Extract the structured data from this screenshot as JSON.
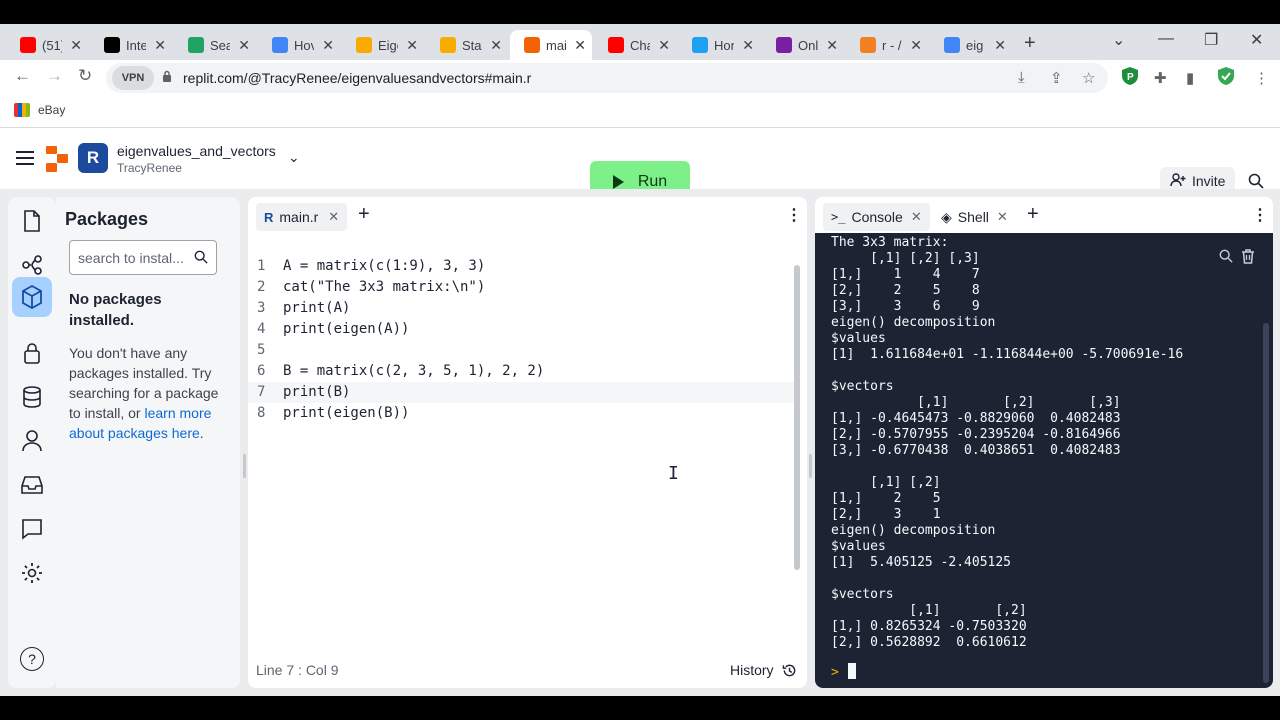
{
  "browser": {
    "tabs": [
      {
        "label": "(51)",
        "icon": "youtube-icon",
        "color": "#ff0000"
      },
      {
        "label": "Inte",
        "icon": "site-icon",
        "color": "#000000"
      },
      {
        "label": "Sea",
        "icon": "google-drive-icon",
        "color": "#1fa463"
      },
      {
        "label": "Hov",
        "icon": "google-docs-icon",
        "color": "#4285f4"
      },
      {
        "label": "Eige",
        "icon": "colab-icon",
        "color": "#f9ab00"
      },
      {
        "label": "Stat",
        "icon": "colab-icon",
        "color": "#f9ab00"
      },
      {
        "label": "mai",
        "icon": "replit-icon",
        "color": "#f26207"
      },
      {
        "label": "Cha",
        "icon": "youtube-icon",
        "color": "#ff0000"
      },
      {
        "label": "Hor",
        "icon": "twitter-icon",
        "color": "#1da1f2"
      },
      {
        "label": "Onl",
        "icon": "site-icon",
        "color": "#7b1fa2"
      },
      {
        "label": "r - /",
        "icon": "site-icon",
        "color": "#f48024"
      },
      {
        "label": "eig",
        "icon": "google-icon",
        "color": "#4285f4"
      }
    ],
    "active_tab_index": 6,
    "url": "replit.com/@TracyRenee/eigenvaluesandvectors#main.r",
    "vpn_label": "VPN",
    "bookmark": "eBay"
  },
  "repl": {
    "name": "eigenvalues_and_vectors",
    "owner": "TracyRenee",
    "run_label": "Run",
    "invite_label": "Invite"
  },
  "packages": {
    "title": "Packages",
    "search_placeholder": "search to instal...",
    "none_title": "No packages installed.",
    "desc": "You don't have any packages installed. Try searching for a package to install, or ",
    "link": "learn more about packages here",
    "desc_end": "."
  },
  "editor": {
    "tab": "main.r",
    "lines": [
      {
        "n": "1",
        "text": "A = matrix(c(1:9), 3, 3)"
      },
      {
        "n": "2",
        "text": "cat(\"The 3x3 matrix:\\n\")"
      },
      {
        "n": "3",
        "text": "print(A)"
      },
      {
        "n": "4",
        "text": "print(eigen(A))"
      },
      {
        "n": "5",
        "text": ""
      },
      {
        "n": "6",
        "text": "B = matrix(c(2, 3, 5, 1), 2, 2)"
      },
      {
        "n": "7",
        "text": "print(B)"
      },
      {
        "n": "8",
        "text": "print(eigen(B))"
      }
    ],
    "current_line": 7,
    "status": "Line 7 : Col 9",
    "history_label": "History"
  },
  "console": {
    "tabs": [
      {
        "label": "Console"
      },
      {
        "label": "Shell"
      }
    ],
    "output": [
      "The 3x3 matrix:",
      "     [,1] [,2] [,3]",
      "[1,]    1    4    7",
      "[2,]    2    5    8",
      "[3,]    3    6    9",
      "eigen() decomposition",
      "$values",
      "[1]  1.611684e+01 -1.116844e+00 -5.700691e-16",
      "",
      "$vectors",
      "           [,1]       [,2]       [,3]",
      "[1,] -0.4645473 -0.8829060  0.4082483",
      "[2,] -0.5707955 -0.2395204 -0.8164966",
      "[3,] -0.6770438  0.4038651  0.4082483",
      "",
      "     [,1] [,2]",
      "[1,]    2    5",
      "[2,]    3    1",
      "eigen() decomposition",
      "$values",
      "[1]  5.405125 -2.405125",
      "",
      "$vectors",
      "          [,1]       [,2]",
      "[1,] 0.8265324 -0.7503320",
      "[2,] 0.5628892  0.6610612"
    ],
    "prompt": ">"
  }
}
